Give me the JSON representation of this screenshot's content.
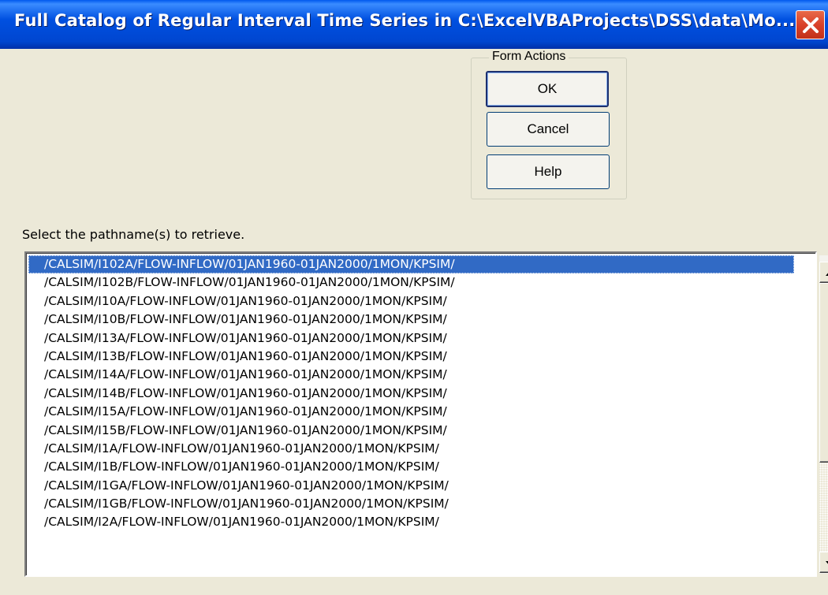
{
  "window": {
    "title": "Full Catalog of Regular Interval Time Series in C:\\ExcelVBAProjects\\DSS\\data\\Mo...",
    "close_icon": "close-x-icon",
    "colors": {
      "titlebar": "#0054E3",
      "close": "#D9412A",
      "selection": "#316AC5",
      "background": "#ECE9D8"
    }
  },
  "form_actions": {
    "legend": "Form Actions",
    "ok_label": "OK",
    "cancel_label": "Cancel",
    "help_label": "Help"
  },
  "prompt": "Select the pathname(s) to retrieve.",
  "pathnames": [
    "/CALSIM/I102A/FLOW-INFLOW/01JAN1960-01JAN2000/1MON/KPSIM/",
    "/CALSIM/I102B/FLOW-INFLOW/01JAN1960-01JAN2000/1MON/KPSIM/",
    "/CALSIM/I10A/FLOW-INFLOW/01JAN1960-01JAN2000/1MON/KPSIM/",
    "/CALSIM/I10B/FLOW-INFLOW/01JAN1960-01JAN2000/1MON/KPSIM/",
    "/CALSIM/I13A/FLOW-INFLOW/01JAN1960-01JAN2000/1MON/KPSIM/",
    "/CALSIM/I13B/FLOW-INFLOW/01JAN1960-01JAN2000/1MON/KPSIM/",
    "/CALSIM/I14A/FLOW-INFLOW/01JAN1960-01JAN2000/1MON/KPSIM/",
    "/CALSIM/I14B/FLOW-INFLOW/01JAN1960-01JAN2000/1MON/KPSIM/",
    "/CALSIM/I15A/FLOW-INFLOW/01JAN1960-01JAN2000/1MON/KPSIM/",
    "/CALSIM/I15B/FLOW-INFLOW/01JAN1960-01JAN2000/1MON/KPSIM/",
    "/CALSIM/I1A/FLOW-INFLOW/01JAN1960-01JAN2000/1MON/KPSIM/",
    "/CALSIM/I1B/FLOW-INFLOW/01JAN1960-01JAN2000/1MON/KPSIM/",
    "/CALSIM/I1GA/FLOW-INFLOW/01JAN1960-01JAN2000/1MON/KPSIM/",
    "/CALSIM/I1GB/FLOW-INFLOW/01JAN1960-01JAN2000/1MON/KPSIM/",
    "/CALSIM/I2A/FLOW-INFLOW/01JAN1960-01JAN2000/1MON/KPSIM/"
  ],
  "selected_index": 0,
  "scrollbar": {
    "up_icon": "scroll-up-arrow-icon",
    "down_icon": "scroll-down-arrow-icon"
  }
}
